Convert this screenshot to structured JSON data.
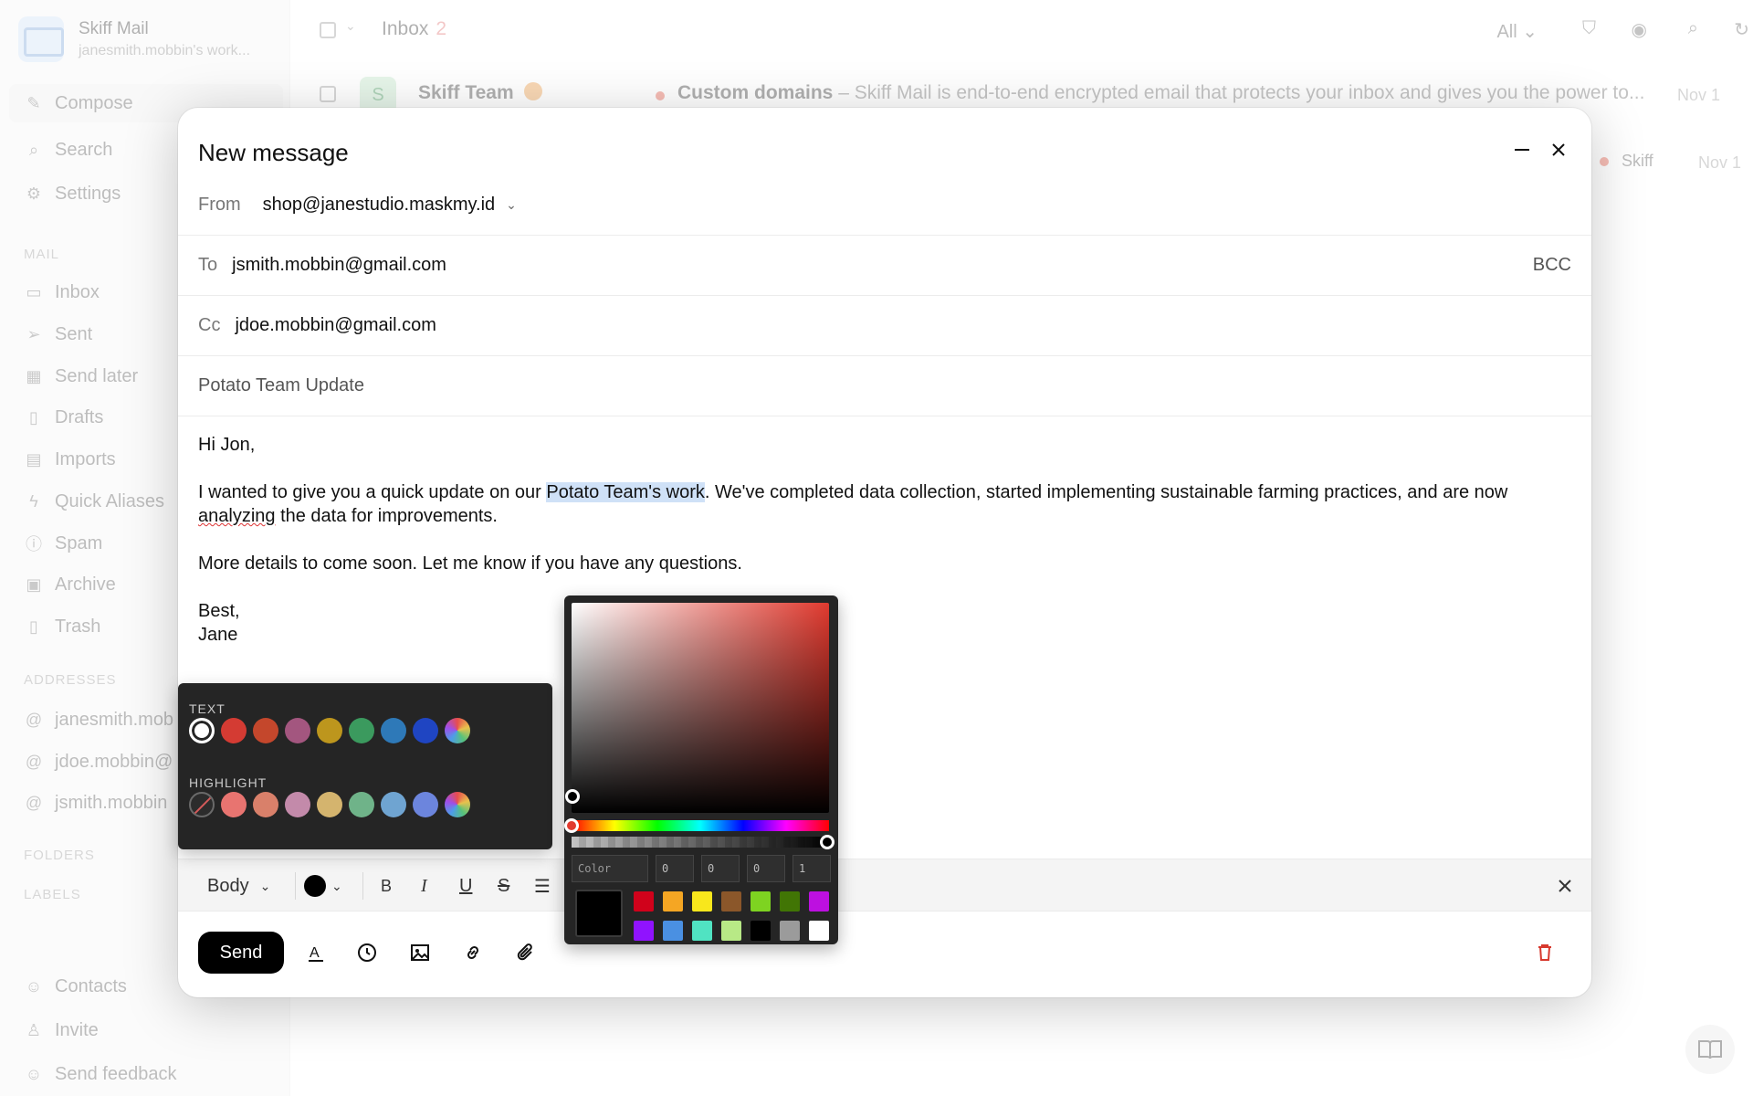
{
  "sidebar": {
    "app_name": "Skiff Mail",
    "account": "janesmith.mobbin's work...",
    "compose": "Compose",
    "search": "Search",
    "settings": "Settings",
    "mail_heading": "MAIL",
    "mail_items": [
      "Inbox",
      "Sent",
      "Send later",
      "Drafts",
      "Imports",
      "Quick Aliases",
      "Spam",
      "Archive",
      "Trash"
    ],
    "addresses_heading": "ADDRESSES",
    "addresses": [
      "janesmith.mob",
      "jdoe.mobbin@",
      "jsmith.mobbin"
    ],
    "folders_heading": "FOLDERS",
    "labels_heading": "LABELS",
    "footer_items": [
      "Contacts",
      "Invite",
      "Send feedback"
    ]
  },
  "inbox": {
    "title": "Inbox",
    "unread_count": "2",
    "filter": "All",
    "row": {
      "sender": "Skiff Team",
      "subject": "Custom domains",
      "preview": " – Skiff Mail is end-to-end encrypted email that protects your inbox and gives you the power to...",
      "date": "Nov 1"
    },
    "row2": {
      "tag": "Skiff",
      "date": "Nov 1"
    }
  },
  "compose": {
    "title": "New message",
    "from_label": "From",
    "from_value": "shop@janestudio.maskmy.id",
    "to_label": "To",
    "to_value": "jsmith.mobbin@gmail.com",
    "bcc_label": "BCC",
    "cc_label": "Cc",
    "cc_value": "jdoe.mobbin@gmail.com",
    "subject": "Potato Team Update",
    "body": {
      "greeting": "Hi Jon,",
      "p1_before": "I wanted to give you a quick update on our ",
      "p1_highlight": "Potato Team's work",
      "p1_after": ". We've completed data collection, started implementing sustainable farming practices, and are now ",
      "p1_misspelled": "analyzing",
      "p1_end": " the data for improvements.",
      "p2": "More details to come soon. Let me know if you have any questions.",
      "signoff": "Best,",
      "name": "Jane"
    },
    "toolbar": {
      "style": "Body"
    },
    "send_label": "Send"
  },
  "color_popover": {
    "text_heading": "TEXT",
    "highlight_heading": "HIGHLIGHT",
    "text_colors": [
      "#ffffff",
      "#d43b33",
      "#c4472c",
      "#a3567f",
      "#bd961d",
      "#3b9a5e",
      "#2e79b8",
      "#1f45c2"
    ],
    "highlight_colors": [
      "#e87470",
      "#d9806a",
      "#c38aaa",
      "#d4b46e",
      "#6fb389",
      "#6fa4d1",
      "#6c85dd"
    ]
  },
  "color_picker": {
    "hue_color": "#e03a2f",
    "input_placeholder": "Color",
    "r": "0",
    "g": "0",
    "b": "0",
    "a": "1",
    "presets": [
      "#d0021b",
      "#f5a623",
      "#f8e71c",
      "#8b572a",
      "#7ed321",
      "#417505",
      "#bd10e0",
      "#9013fe",
      "#4a90e2",
      "#50e3c2",
      "#b8e986",
      "#000000",
      "#9b9b9b",
      "#ffffff"
    ]
  }
}
